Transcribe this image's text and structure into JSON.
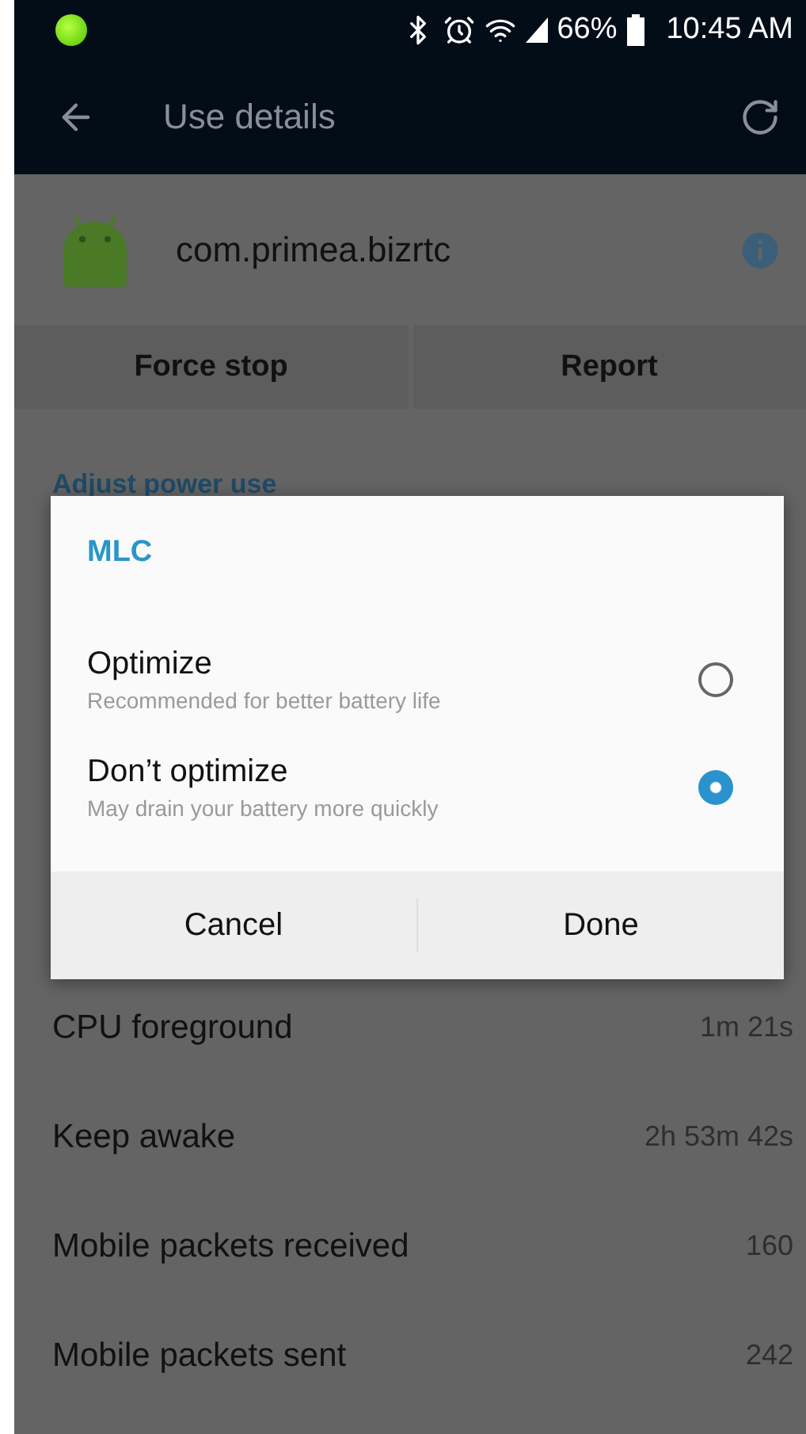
{
  "status_bar": {
    "battery": "66%",
    "time": "10:45 AM"
  },
  "app_bar": {
    "title": "Use details"
  },
  "app": {
    "name": "com.primea.bizrtc"
  },
  "actions": [
    "Force stop",
    "Report"
  ],
  "section": {
    "title": "Adjust power use"
  },
  "stats": [
    {
      "label": "CPU foreground",
      "value": "1m 21s"
    },
    {
      "label": "Keep awake",
      "value": "2h 53m 42s"
    },
    {
      "label": "Mobile packets received",
      "value": "160"
    },
    {
      "label": "Mobile packets sent",
      "value": "242"
    }
  ],
  "dialog": {
    "title": "MLC",
    "options": [
      {
        "label": "Optimize",
        "description": "Recommended for better battery life",
        "selected": false
      },
      {
        "label": "Don’t optimize",
        "description": "May drain your battery more quickly",
        "selected": true
      }
    ],
    "buttons": [
      "Cancel",
      "Done"
    ]
  }
}
